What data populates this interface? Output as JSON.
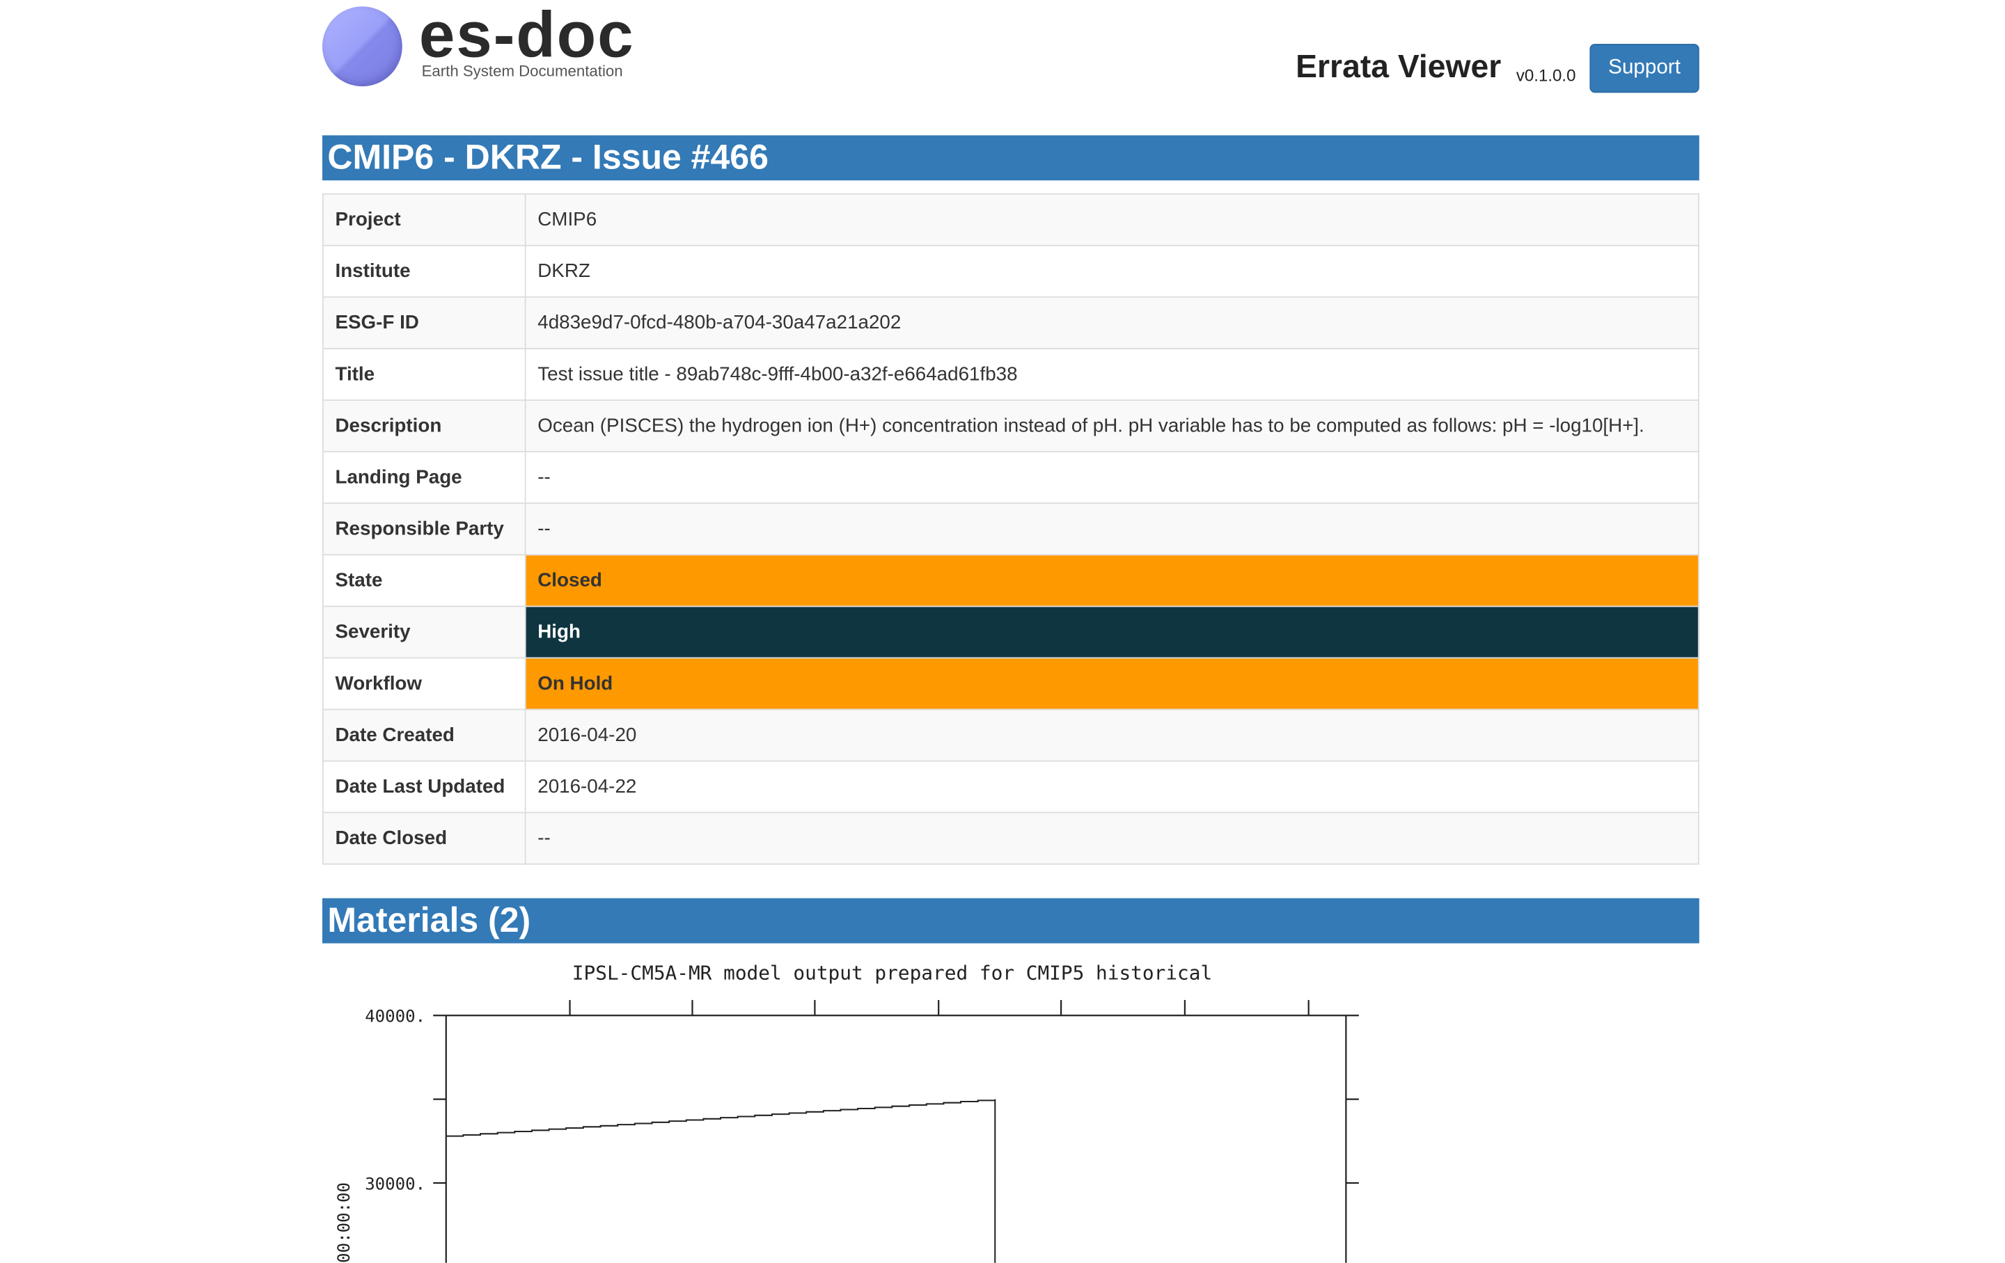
{
  "header": {
    "logo_text": "es-doc",
    "logo_subtitle": "Earth System Documentation",
    "app_title": "Errata Viewer",
    "app_version": "v0.1.0.0",
    "support_label": "Support"
  },
  "issue": {
    "heading": "CMIP6 - DKRZ - Issue #466",
    "rows": [
      {
        "label": "Project",
        "value": "CMIP6"
      },
      {
        "label": "Institute",
        "value": "DKRZ"
      },
      {
        "label": "ESG-F ID",
        "value": "4d83e9d7-0fcd-480b-a704-30a47a21a202"
      },
      {
        "label": "Title",
        "value": "Test issue title - 89ab748c-9fff-4b00-a32f-e664ad61fb38"
      },
      {
        "label": "Description",
        "value": "Ocean (PISCES) the hydrogen ion (H+) concentration instead of pH. pH variable has to be computed as follows: pH = -log10[H+]."
      },
      {
        "label": "Landing Page",
        "value": "--"
      },
      {
        "label": "Responsible Party",
        "value": "--"
      },
      {
        "label": "State",
        "value": "Closed"
      },
      {
        "label": "Severity",
        "value": "High"
      },
      {
        "label": "Workflow",
        "value": "On Hold"
      },
      {
        "label": "Date Created",
        "value": "2016-04-20"
      },
      {
        "label": "Date Last Updated",
        "value": "2016-04-22"
      },
      {
        "label": "Date Closed",
        "value": "--"
      }
    ]
  },
  "colors": {
    "header_blue": "#337ab7",
    "state_closed": "#ff9900",
    "severity_high": "#0e3540",
    "workflow_on_hold": "#ff9900"
  },
  "materials": {
    "heading": "Materials (2)"
  },
  "chart_data": {
    "type": "line",
    "title": "IPSL-CM5A-MR model output prepared for CMIP5 historical",
    "ylabel": "00:00:00",
    "ytick_labels": [
      "40000.",
      "30000."
    ],
    "series": [
      {
        "points": [
          [
            0,
            32800
          ],
          [
            0.61,
            35000
          ]
        ],
        "drop_to_visible_bottom": true
      }
    ],
    "ylim_visible": [
      25000,
      40000
    ]
  }
}
